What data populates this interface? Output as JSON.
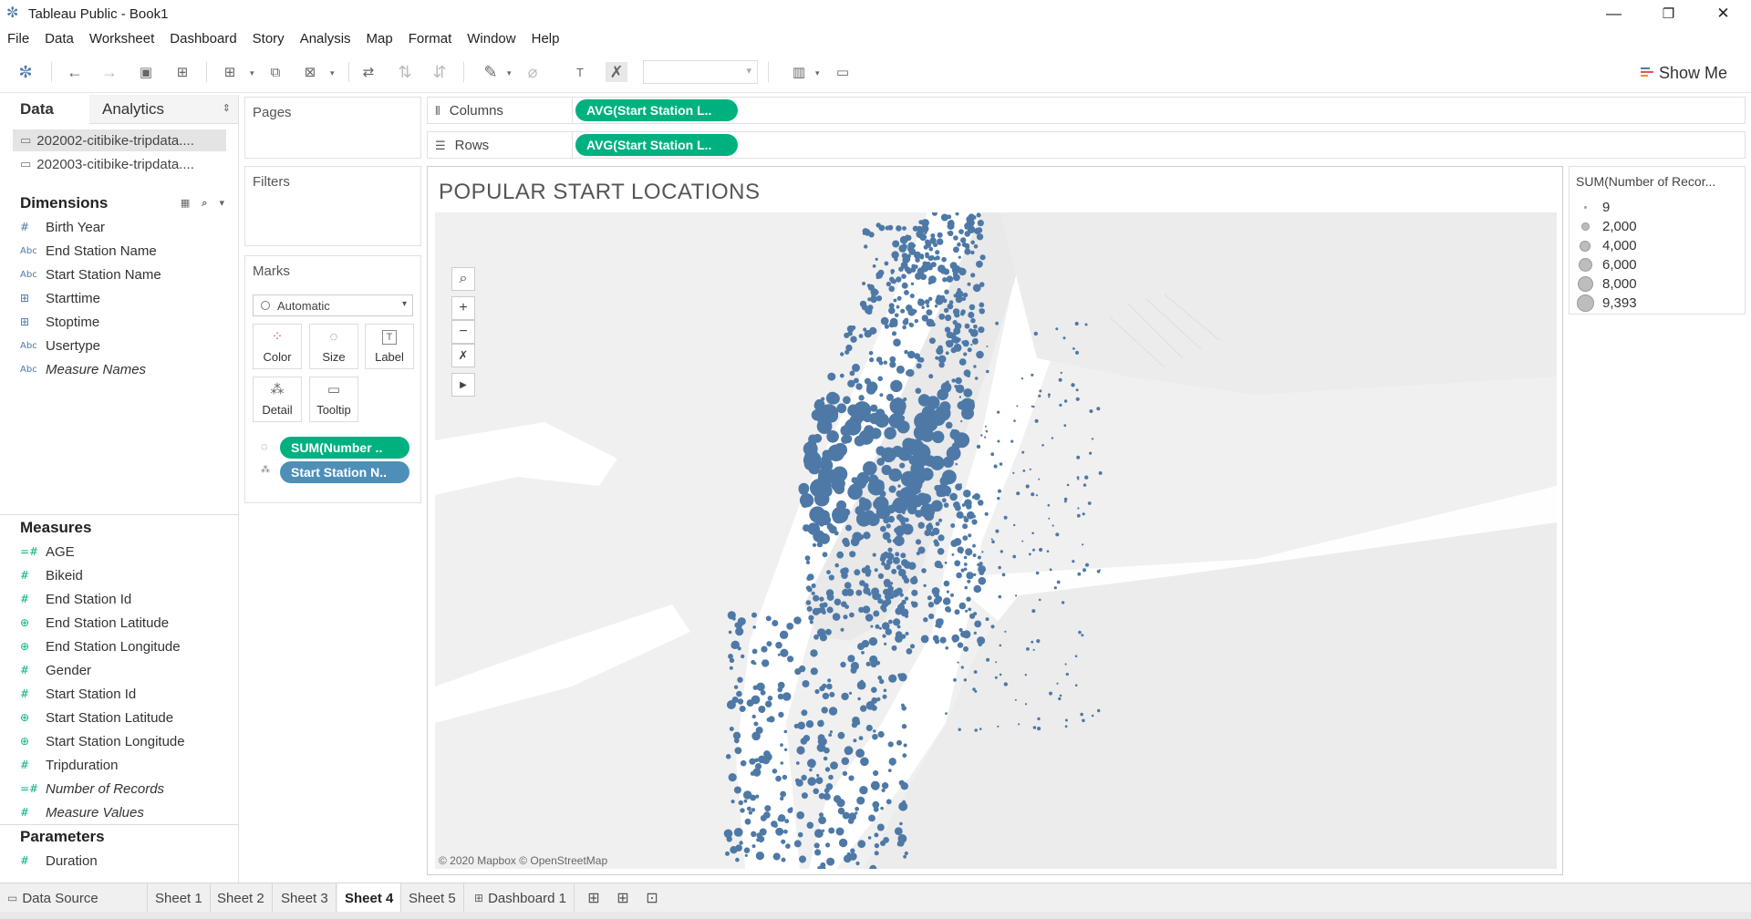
{
  "window": {
    "title": "Tableau Public - Book1",
    "controls": {
      "minimize": "—",
      "restore": "❐",
      "close": "✕"
    }
  },
  "menu": [
    "File",
    "Data",
    "Worksheet",
    "Dashboard",
    "Story",
    "Analysis",
    "Map",
    "Format",
    "Window",
    "Help"
  ],
  "toolbar": {
    "show_me": "Show Me",
    "icons": [
      "tableau-logo-icon",
      "undo-icon",
      "redo-icon",
      "save-icon",
      "new-data-source-icon",
      "new-worksheet-icon",
      "duplicate-sheet-icon",
      "clear-sheet-icon",
      "swap-icon",
      "sort-ascending-icon",
      "sort-descending-icon",
      "highlight-icon",
      "group-icon",
      "show-labels-icon",
      "fix-axes-icon",
      "fit-icon",
      "presentation-icon"
    ],
    "accent_color": "#4e79a7"
  },
  "data_pane": {
    "tabs": {
      "data": "Data",
      "analytics": "Analytics"
    },
    "sources": [
      "202002-citibike-tripdata....",
      "202003-citibike-tripdata...."
    ],
    "dimensions_header": "Dimensions",
    "dimensions": [
      {
        "icon": "#",
        "label": "Birth Year"
      },
      {
        "icon": "Abc",
        "label": "End Station Name"
      },
      {
        "icon": "Abc",
        "label": "Start Station Name"
      },
      {
        "icon": "⊞",
        "label": "Starttime"
      },
      {
        "icon": "⊞",
        "label": "Stoptime"
      },
      {
        "icon": "Abc",
        "label": "Usertype"
      },
      {
        "icon": "Abc",
        "label": "Measure Names"
      }
    ],
    "measures_header": "Measures",
    "measures": [
      {
        "icon": "=#",
        "label": "AGE"
      },
      {
        "icon": "#",
        "label": "Bikeid"
      },
      {
        "icon": "#",
        "label": "End Station Id"
      },
      {
        "icon": "⊕",
        "label": "End Station Latitude"
      },
      {
        "icon": "⊕",
        "label": "End Station Longitude"
      },
      {
        "icon": "#",
        "label": "Gender"
      },
      {
        "icon": "#",
        "label": "Start Station Id"
      },
      {
        "icon": "⊕",
        "label": "Start Station Latitude"
      },
      {
        "icon": "⊕",
        "label": "Start Station Longitude"
      },
      {
        "icon": "#",
        "label": "Tripduration"
      },
      {
        "icon": "=#",
        "label": "Number of Records"
      },
      {
        "icon": "#",
        "label": "Measure Values"
      }
    ],
    "parameters_header": "Parameters",
    "parameters": [
      {
        "icon": "#",
        "label": "Duration"
      }
    ]
  },
  "cards": {
    "pages": "Pages",
    "filters": "Filters",
    "marks": "Marks",
    "mark_type": "Automatic",
    "mark_buttons": [
      {
        "icon": "⁘",
        "label": "Color"
      },
      {
        "icon": "◌",
        "label": "Size"
      },
      {
        "icon": "T",
        "label": "Label"
      },
      {
        "icon": "⁂",
        "label": "Detail"
      },
      {
        "icon": "▭",
        "label": "Tooltip"
      }
    ],
    "mark_pills": [
      "SUM(Number ..",
      "Start Station N.."
    ]
  },
  "shelves": {
    "columns_label": "Columns",
    "rows_label": "Rows",
    "columns_pill": "AVG(Start Station L..",
    "rows_pill": "AVG(Start Station L.."
  },
  "view": {
    "title": "POPULAR START LOCATIONS",
    "attribution": "© 2020 Mapbox © OpenStreetMap",
    "map_tools": [
      "search-icon",
      "zoom-in-icon",
      "zoom-out-icon",
      "pan-icon",
      "expand-icon"
    ],
    "mark_color": "#4e79a7"
  },
  "legend": {
    "title": "SUM(Number of Recor...",
    "items": [
      "9",
      "2,000",
      "4,000",
      "6,000",
      "8,000",
      "9,393"
    ]
  },
  "sheet_tabs": {
    "data_source": "Data Source",
    "sheets": [
      "Sheet 1",
      "Sheet 2",
      "Sheet 3",
      "Sheet 4",
      "Sheet 5"
    ],
    "active": "Sheet 4",
    "dashboard": "Dashboard 1"
  }
}
